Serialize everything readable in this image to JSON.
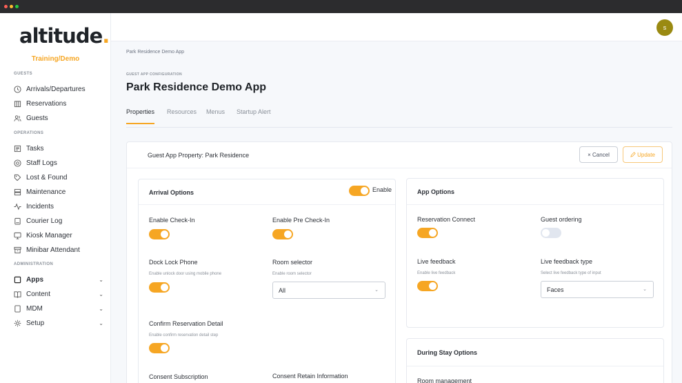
{
  "brand": {
    "logo_text": "altitude",
    "logo_dot": ".",
    "subtitle": "Training/Demo"
  },
  "colors": {
    "accent": "#f6a623",
    "avatar": "#9a8a12",
    "traffic_lights": [
      "#ff5f57",
      "#febc2e",
      "#28c840"
    ]
  },
  "sidebar": {
    "sections": {
      "guests": "GUESTS",
      "operations": "OPERATIONS",
      "administration": "ADMINISTRATION"
    },
    "items": [
      {
        "label": "Arrivals/Departures",
        "icon": "clock-icon"
      },
      {
        "label": "Reservations",
        "icon": "building-icon"
      },
      {
        "label": "Guests",
        "icon": "users-icon"
      },
      {
        "label": "Tasks",
        "icon": "tasks-icon"
      },
      {
        "label": "Staff Logs",
        "icon": "at-icon"
      },
      {
        "label": "Lost & Found",
        "icon": "tag-icon"
      },
      {
        "label": "Maintenance",
        "icon": "server-icon"
      },
      {
        "label": "Incidents",
        "icon": "activity-icon"
      },
      {
        "label": "Courier Log",
        "icon": "clipboard-icon"
      },
      {
        "label": "Kiosk Manager",
        "icon": "monitor-icon"
      },
      {
        "label": "Minibar Attendant",
        "icon": "archive-icon"
      },
      {
        "label": "Apps",
        "icon": "square-icon"
      },
      {
        "label": "Content",
        "icon": "book-icon"
      },
      {
        "label": "MDM",
        "icon": "device-icon"
      },
      {
        "label": "Setup",
        "icon": "gear-icon"
      }
    ]
  },
  "user": {
    "avatar_initial": "s"
  },
  "page": {
    "breadcrumb": "Park Residence Demo App",
    "eyebrow": "GUEST APP CONFIGURATION",
    "title": "Park Residence Demo App",
    "tabs": [
      "Properties",
      "Resources",
      "Menus",
      "Startup Alert"
    ],
    "active_tab": "Properties"
  },
  "card": {
    "title": "Guest App Property: Park Residence",
    "cancel_label": "× Cancel",
    "update_label": "Update"
  },
  "arrival": {
    "title": "Arrival Options",
    "enable_label": "Enable",
    "enabled": true,
    "check_in": {
      "label": "Enable Check-In",
      "on": true
    },
    "pre_check_in": {
      "label": "Enable Pre Check-In",
      "on": true
    },
    "dock_lock": {
      "label": "Dock Lock Phone",
      "help": "Enable unlock door using mobile phone",
      "on": true
    },
    "room_selector": {
      "label": "Room selector",
      "help": "Enable room selector",
      "value": "All"
    },
    "confirm": {
      "label": "Confirm Reservation Detail",
      "help": "Enable confirm reservation detail step",
      "on": true
    },
    "consent_subscription": {
      "label": "Consent Subscription"
    },
    "consent_retain": {
      "label": "Consent Retain Information"
    }
  },
  "app_options": {
    "title": "App Options",
    "reservation_connect": {
      "label": "Reservation Connect",
      "on": true
    },
    "guest_ordering": {
      "label": "Guest ordering",
      "on": false
    },
    "live_feedback": {
      "label": "Live feedback",
      "help": "Enable live feedback",
      "on": true
    },
    "feedback_type": {
      "label": "Live feedback type",
      "help": "Select live feedback type of input",
      "value": "Faces"
    }
  },
  "during_stay": {
    "title": "During Stay Options",
    "room_management": {
      "label": "Room management"
    }
  }
}
